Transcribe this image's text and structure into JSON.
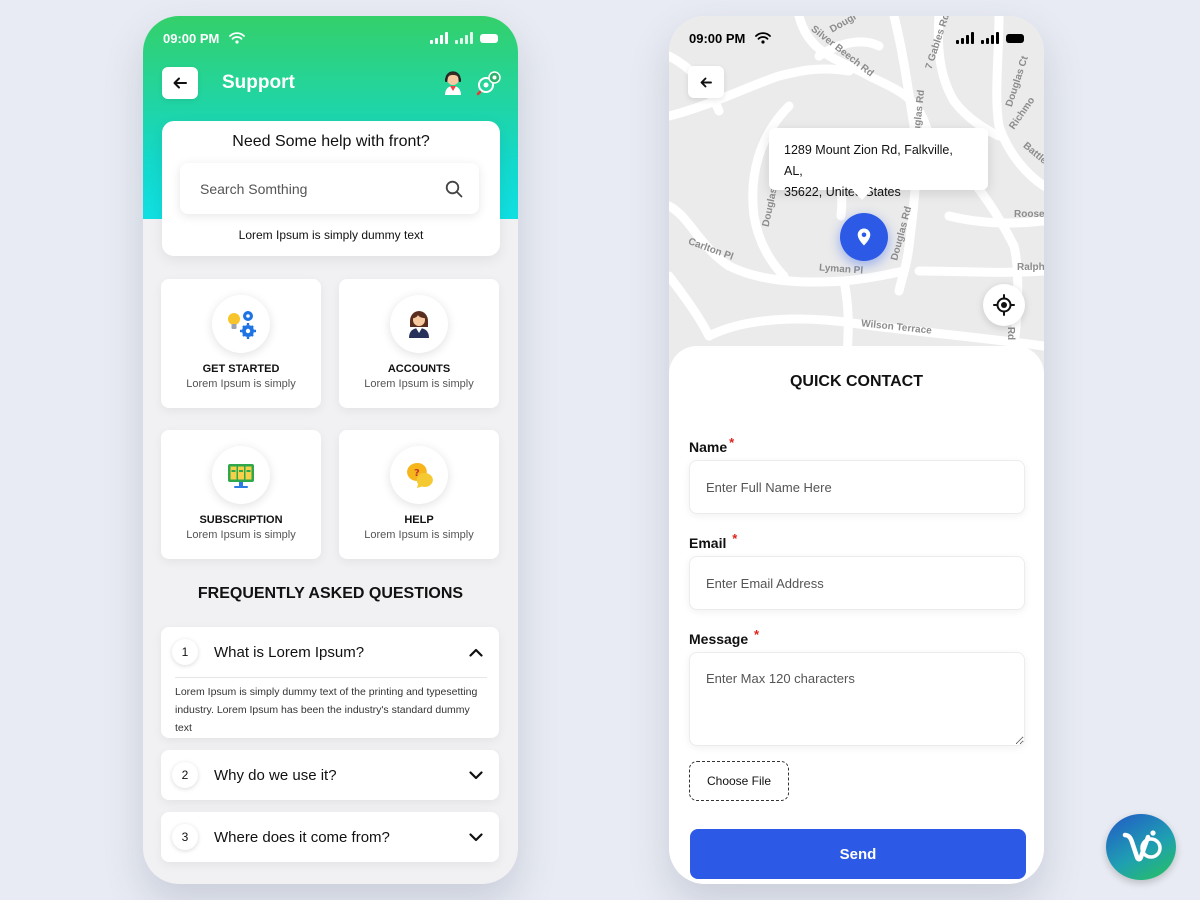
{
  "support_screen": {
    "status": {
      "time": "09:00 PM"
    },
    "header": {
      "title": "Support",
      "icons": [
        "back-arrow-icon",
        "agent-avatar-icon",
        "settings-gear-icon"
      ]
    },
    "help_card": {
      "question": "Need Some help with front?",
      "search_placeholder": "Search Somthing",
      "subtitle": "Lorem Ipsum is simply dummy text"
    },
    "tiles": [
      {
        "title": "GET STARTED",
        "subtitle": "Lorem Ipsum is simply",
        "icon": "gears-bulb-icon"
      },
      {
        "title": "ACCOUNTS",
        "subtitle": "Lorem Ipsum is simply",
        "icon": "user-icon"
      },
      {
        "title": "SUBSCRIPTION",
        "subtitle": "Lorem Ipsum is simply",
        "icon": "plans-screen-icon"
      },
      {
        "title": "HELP",
        "subtitle": "Lorem Ipsum is simply",
        "icon": "chat-question-icon"
      }
    ],
    "faq": {
      "title": "FREQUENTLY ASKED QUESTIONS",
      "items": [
        {
          "number": "1",
          "question": "What is Lorem Ipsum?",
          "answer": "Lorem Ipsum is simply dummy text of the printing and typesetting industry. Lorem Ipsum has been the industry's standard dummy text",
          "expanded": true
        },
        {
          "number": "2",
          "question": "Why do we use it?",
          "expanded": false
        },
        {
          "number": "3",
          "question": "Where does it come from?",
          "expanded": false
        }
      ]
    }
  },
  "contact_screen": {
    "status": {
      "time": "09:00 PM"
    },
    "map": {
      "address_line1": "1289 Mount Zion Rd, Falkville, AL,",
      "address_line2": "35622, United States",
      "street_labels": [
        "Silver Beech Rd",
        "Dougl",
        "7 Gables Rd",
        "Douglas Ct",
        "Richmo",
        "Battle",
        "Douglas Rd",
        "Douglas Rd",
        "Douglas Rd",
        "Roose",
        "Ralph",
        "Carlton Pl",
        "Lyman Pl",
        "Wilson Terrace",
        "Rd"
      ]
    },
    "form": {
      "title": "QUICK CONTACT",
      "required_mark": "*",
      "name_label": "Name",
      "name_placeholder": "Enter Full Name Here",
      "email_label": "Email",
      "email_placeholder": "Enter Email Address",
      "message_label": "Message",
      "message_placeholder": "Enter Max 120 characters",
      "file_button": "Choose File",
      "send_button": "Send"
    }
  },
  "colors": {
    "gradient_top": "#34d06a",
    "gradient_bottom": "#10dfe2",
    "primary_blue": "#2c5ae6",
    "required_red": "#e0221b"
  }
}
